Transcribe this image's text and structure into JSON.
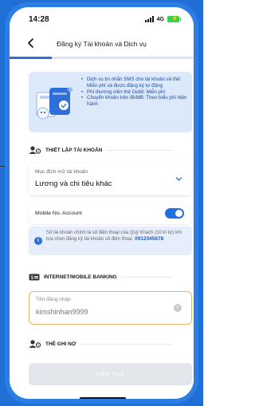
{
  "status": {
    "time": "14:28",
    "network": "4G"
  },
  "header": {
    "title": "Đăng ký Tài khoản và Dịch vụ"
  },
  "progress": {
    "value": 0.23
  },
  "promo": {
    "items": [
      "Dịch vụ tin nhắn SMS cho tài khoản và thẻ: Miễn phí và được đăng ký tự động",
      "Phí thường niên thẻ Debit: Miễn phí",
      "Chuyển khoản trên IB/MB: Theo biểu phí hiện hành"
    ]
  },
  "sections": {
    "account_setup": "THIẾT LẬP TÀI KHOẢN",
    "internet_banking": "INTERNET/MOBILE BANKING",
    "debit_card": "THẺ GHI NỢ"
  },
  "purpose": {
    "caption": "Mục đích mở tài khoản",
    "value": "Lương và chi tiêu khác"
  },
  "mobile_account": {
    "label": "Mobile No. Account",
    "enabled": true
  },
  "info": {
    "text": "Số tài khoản chính là số điện thoại của Quý Khách (10 kí tự) khi lựa chọn đăng ký tài khoản số điện thoại.",
    "phone": "0912345678"
  },
  "login": {
    "caption": "Tên đăng nhập",
    "value": "kimshinhan9999"
  },
  "buttons": {
    "continue": "TIẾP TỤC"
  },
  "colors": {
    "accent": "#1e6fe0",
    "promo_bg": "#dce9fb",
    "input_border": "#f2b46b"
  },
  "icons": {
    "back": "chevron-left-icon",
    "dropdown": "chevron-down-icon",
    "info": "info-icon",
    "clear": "clear-icon",
    "user_settings": "user-settings-icon",
    "card": "card-icon"
  }
}
